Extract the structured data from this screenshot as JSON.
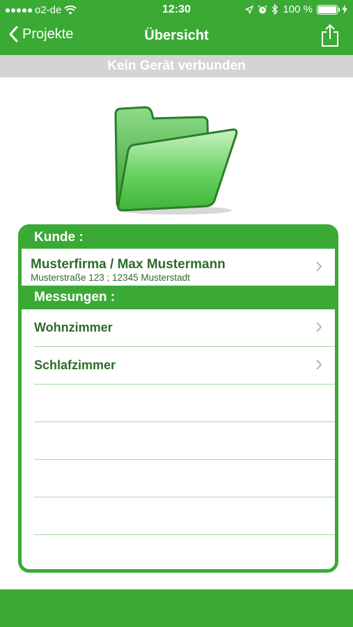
{
  "status_bar": {
    "carrier": "o2-de",
    "time": "12:30",
    "battery": "100 %"
  },
  "nav": {
    "back_label": "Projekte",
    "title": "Übersicht",
    "share_icon": "share-icon"
  },
  "banner": {
    "text": "Kein Gerät verbunden"
  },
  "customer_section": {
    "header": "Kunde :",
    "name": "Musterfirma / Max Mustermann",
    "address": "Musterstraße 123 ; 12345 Musterstadt"
  },
  "measurements_section": {
    "header": "Messungen :",
    "items": [
      {
        "label": "Wohnzimmer"
      },
      {
        "label": "Schlafzimmer"
      }
    ]
  },
  "colors": {
    "accent": "#3aaa35",
    "text_green": "#2e6b2a",
    "banner_gray": "#d4d4d4"
  }
}
